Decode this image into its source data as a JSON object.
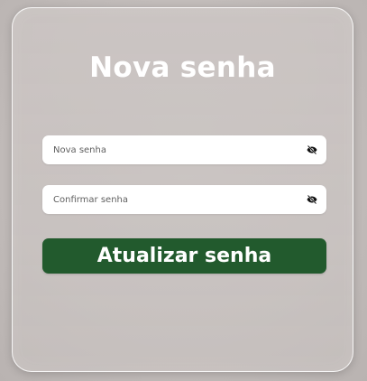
{
  "card": {
    "title": "Nova senha"
  },
  "fields": [
    {
      "placeholder": "Nova senha",
      "value": "",
      "icon": "eye-slash-icon"
    },
    {
      "placeholder": "Confirmar senha",
      "value": "",
      "icon": "eye-slash-icon"
    }
  ],
  "submit": {
    "label": "Atualizar senha"
  },
  "colors": {
    "background": "#c3bdbb",
    "button": "#225a2d",
    "title": "#ffffff",
    "field": "#ffffff"
  }
}
